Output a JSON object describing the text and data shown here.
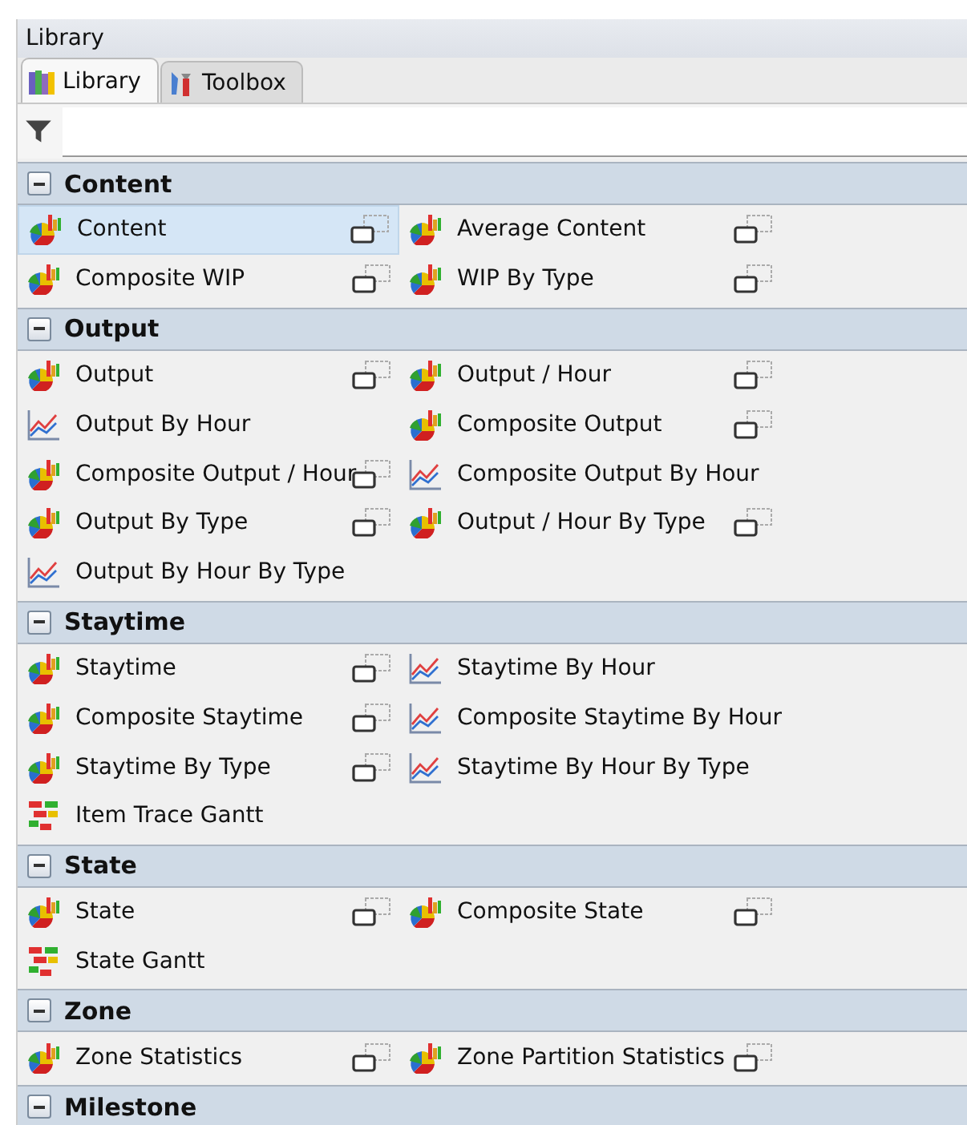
{
  "window": {
    "title": "Library"
  },
  "tabs": [
    {
      "label": "Library",
      "selected": true,
      "kind": "library"
    },
    {
      "label": "Toolbox",
      "selected": false,
      "kind": "toolbox"
    }
  ],
  "sections": [
    {
      "title": "Content",
      "expanded": true,
      "items": [
        {
          "label": "Content",
          "kind": "pie",
          "popout": true,
          "selected": true
        },
        {
          "label": "Average Content",
          "kind": "pie",
          "popout": true,
          "selected": false
        },
        {
          "label": "Composite WIP",
          "kind": "pie",
          "popout": true,
          "selected": false
        },
        {
          "label": "WIP By Type",
          "kind": "pie",
          "popout": true,
          "selected": false
        }
      ]
    },
    {
      "title": "Output",
      "expanded": true,
      "items": [
        {
          "label": "Output",
          "kind": "pie",
          "popout": true,
          "selected": false
        },
        {
          "label": "Output / Hour",
          "kind": "pie",
          "popout": true,
          "selected": false
        },
        {
          "label": "Output By Hour",
          "kind": "line",
          "popout": false,
          "selected": false
        },
        {
          "label": "Composite Output",
          "kind": "pie",
          "popout": true,
          "selected": false
        },
        {
          "label": "Composite Output / Hour",
          "kind": "pie",
          "popout": true,
          "selected": false
        },
        {
          "label": "Composite Output By Hour",
          "kind": "line",
          "popout": false,
          "selected": false
        },
        {
          "label": "Output By Type",
          "kind": "pie",
          "popout": true,
          "selected": false
        },
        {
          "label": "Output / Hour By Type",
          "kind": "pie",
          "popout": true,
          "selected": false
        },
        {
          "label": "Output By Hour By Type",
          "kind": "line",
          "popout": false,
          "selected": false
        }
      ]
    },
    {
      "title": "Staytime",
      "expanded": true,
      "items": [
        {
          "label": "Staytime",
          "kind": "pie",
          "popout": true,
          "selected": false
        },
        {
          "label": "Staytime By Hour",
          "kind": "line",
          "popout": false,
          "selected": false
        },
        {
          "label": "Composite Staytime",
          "kind": "pie",
          "popout": true,
          "selected": false
        },
        {
          "label": "Composite Staytime By Hour",
          "kind": "line",
          "popout": false,
          "selected": false
        },
        {
          "label": "Staytime By Type",
          "kind": "pie",
          "popout": true,
          "selected": false
        },
        {
          "label": "Staytime By Hour By Type",
          "kind": "line",
          "popout": false,
          "selected": false
        },
        {
          "label": "Item Trace Gantt",
          "kind": "gantt",
          "popout": false,
          "selected": false
        }
      ]
    },
    {
      "title": "State",
      "expanded": true,
      "items": [
        {
          "label": "State",
          "kind": "pie",
          "popout": true,
          "selected": false
        },
        {
          "label": "Composite State",
          "kind": "pie",
          "popout": true,
          "selected": false
        },
        {
          "label": "State Gantt",
          "kind": "gantt",
          "popout": false,
          "selected": false
        }
      ]
    },
    {
      "title": "Zone",
      "expanded": true,
      "items": [
        {
          "label": "Zone Statistics",
          "kind": "pie",
          "popout": true,
          "selected": false
        },
        {
          "label": "Zone Partition Statistics",
          "kind": "pie",
          "popout": true,
          "selected": false
        }
      ]
    },
    {
      "title": "Milestone",
      "expanded": true
    }
  ]
}
